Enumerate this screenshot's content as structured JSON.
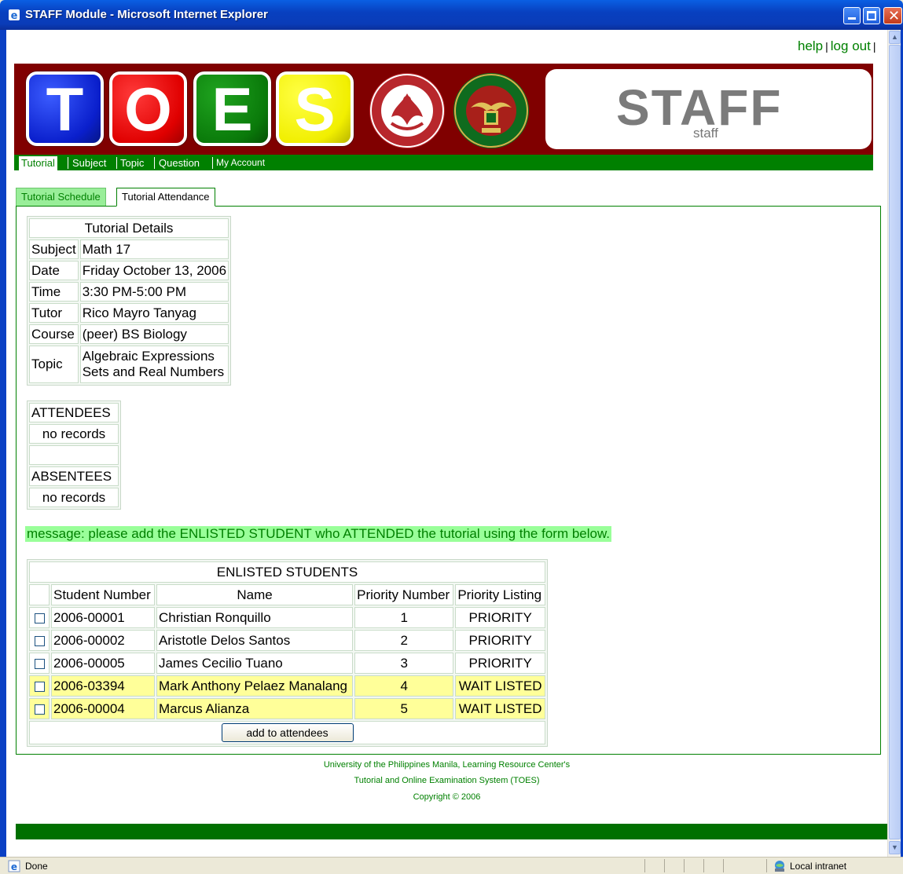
{
  "window": {
    "title": "STAFF Module - Microsoft Internet Explorer"
  },
  "toplinks": {
    "help": "help",
    "logout": "log out"
  },
  "banner": {
    "letters": [
      "T",
      "O",
      "E",
      "S"
    ],
    "staff_big": "STAFF",
    "staff_small": "staff"
  },
  "nav": [
    "Tutorial",
    "Subject",
    "Topic",
    "Question",
    "My Account"
  ],
  "subtabs": [
    "Tutorial Schedule",
    "Tutorial Attendance"
  ],
  "details": {
    "header": "Tutorial Details",
    "rows": [
      {
        "label": "Subject",
        "value": "Math 17"
      },
      {
        "label": "Date",
        "value": "Friday October 13, 2006"
      },
      {
        "label": "Time",
        "value": "3:30 PM-5:00 PM"
      },
      {
        "label": "Tutor",
        "value": "Rico Mayro Tanyag"
      },
      {
        "label": "Course",
        "value": "(peer) BS Biology"
      },
      {
        "label": "Topic",
        "value": "Algebraic Expressions",
        "value2": "Sets and Real Numbers"
      }
    ]
  },
  "attendance": {
    "attendees_label": "ATTENDEES",
    "attendees_value": "no records",
    "absentees_label": "ABSENTEES",
    "absentees_value": "no records"
  },
  "message": "message: please add the ENLISTED STUDENT who ATTENDED the tutorial using the form below.",
  "enlisted": {
    "header": "ENLISTED STUDENTS",
    "columns": [
      "Student Number",
      "Name",
      "Priority Number",
      "Priority Listing"
    ],
    "rows": [
      {
        "number": "2006-00001",
        "name": "Christian Ronquillo",
        "priority": "1",
        "listing": "PRIORITY"
      },
      {
        "number": "2006-00002",
        "name": "Aristotle Delos Santos",
        "priority": "2",
        "listing": "PRIORITY"
      },
      {
        "number": "2006-00005",
        "name": "James Cecilio Tuano",
        "priority": "3",
        "listing": "PRIORITY"
      },
      {
        "number": "2006-03394",
        "name": "Mark Anthony Pelaez Manalang",
        "priority": "4",
        "listing": "WAIT LISTED"
      },
      {
        "number": "2006-00004",
        "name": "Marcus Alianza",
        "priority": "5",
        "listing": "WAIT LISTED"
      }
    ],
    "button": "add to attendees"
  },
  "footer": {
    "line1": "University of the Philippines Manila, Learning Resource Center's",
    "line2": "Tutorial and Online Examination System (TOES)",
    "line3": "Copyright © 2006"
  },
  "status": {
    "text": "Done",
    "zone": "Local intranet"
  },
  "colors": {
    "green": "#008000",
    "maroon": "#800000",
    "wait_listed": "#ffff99",
    "message_bg": "#99ff99"
  }
}
